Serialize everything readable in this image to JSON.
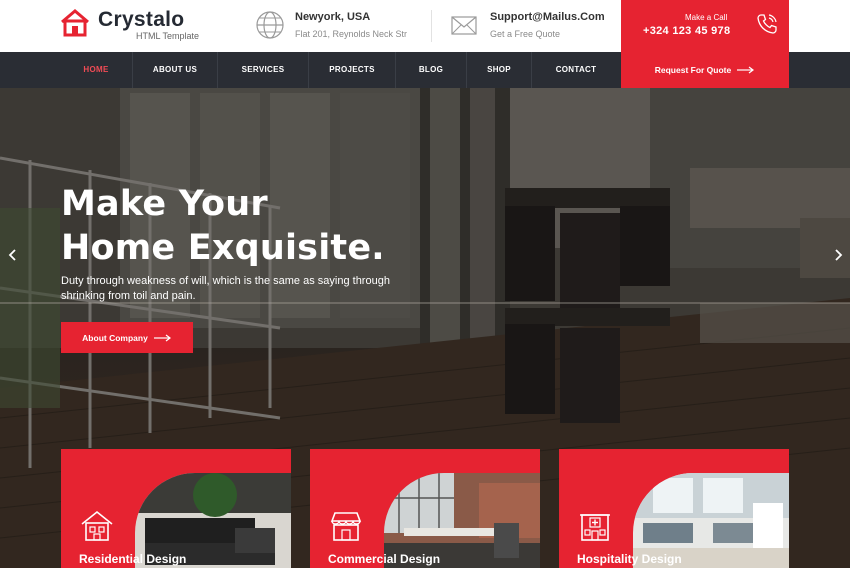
{
  "brand": {
    "name": "Crystalo",
    "tagline": "HTML Template",
    "icon": "house-logo-icon"
  },
  "header": {
    "location": {
      "title": "Newyork, USA",
      "subtitle": "Flat 201, Reynolds Neck Str",
      "icon": "globe-icon"
    },
    "email": {
      "title": "Support@Mailus.Com",
      "subtitle": "Get a Free Quote",
      "icon": "envelope-icon"
    },
    "call": {
      "label": "Make a Call",
      "number": "+324 123 45 978",
      "icon": "phone-icon"
    }
  },
  "nav": {
    "items": [
      {
        "label": "HOME",
        "active": true
      },
      {
        "label": "ABOUT US",
        "active": false
      },
      {
        "label": "SERVICES",
        "active": false
      },
      {
        "label": "PROJECTS",
        "active": false
      },
      {
        "label": "BLOG",
        "active": false
      },
      {
        "label": "SHOP",
        "active": false
      },
      {
        "label": "CONTACT",
        "active": false
      }
    ],
    "quote_button": "Request For Quote"
  },
  "hero": {
    "title_line1": "Make Your",
    "title_line2": "Home Exquisite.",
    "description": "Duty through weakness of will, which is the same as saying through shrinking from toil and pain.",
    "button": "About Company"
  },
  "services": [
    {
      "label": "Residential Design",
      "icon": "house-icon"
    },
    {
      "label": "Commercial Design",
      "icon": "shop-icon"
    },
    {
      "label": "Hospitality Design",
      "icon": "hospital-icon"
    }
  ],
  "colors": {
    "accent": "#e62331",
    "nav_bg": "#2a2d34",
    "active_nav": "#f04b55",
    "heading": "#252a33"
  }
}
